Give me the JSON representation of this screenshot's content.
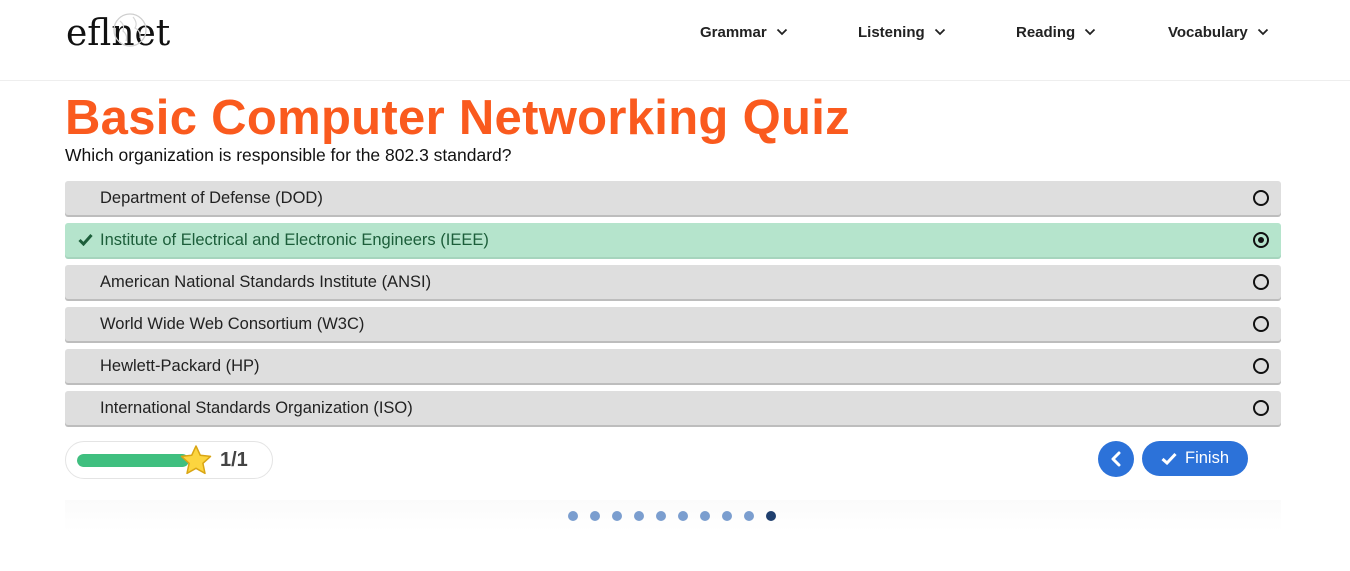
{
  "header": {
    "logo_text": "eflnet",
    "nav": [
      {
        "label": "Grammar"
      },
      {
        "label": "Listening"
      },
      {
        "label": "Reading"
      },
      {
        "label": "Vocabulary"
      }
    ]
  },
  "quiz": {
    "title": "Basic Computer Networking Quiz",
    "question": "Which organization is responsible for the 802.3 standard?",
    "options": [
      {
        "label": "Department of Defense (DOD)",
        "selected": false,
        "correct": false
      },
      {
        "label": "Institute of Electrical and Electronic Engineers (IEEE)",
        "selected": true,
        "correct": true
      },
      {
        "label": "American National Standards Institute (ANSI)",
        "selected": false,
        "correct": false
      },
      {
        "label": "World Wide Web Consortium (W3C)",
        "selected": false,
        "correct": false
      },
      {
        "label": "Hewlett-Packard (HP)",
        "selected": false,
        "correct": false
      },
      {
        "label": "International Standards Organization (ISO)",
        "selected": false,
        "correct": false
      }
    ]
  },
  "progress": {
    "score": "1/1",
    "fill_fraction": 1.0,
    "icon": "star-icon"
  },
  "controls": {
    "prev_icon": "chevron-left-icon",
    "finish_label": "Finish",
    "finish_icon": "check-icon"
  },
  "pagination": {
    "total": 10,
    "active_index": 9
  },
  "colors": {
    "title": "#fa5a1e",
    "correct_bg": "#b5e4cc",
    "option_bg": "#dedede",
    "progress_fill": "#3fbf7f",
    "button": "#2c72d9",
    "dot": "#7b9ecf",
    "dot_active": "#1f3f6e"
  }
}
